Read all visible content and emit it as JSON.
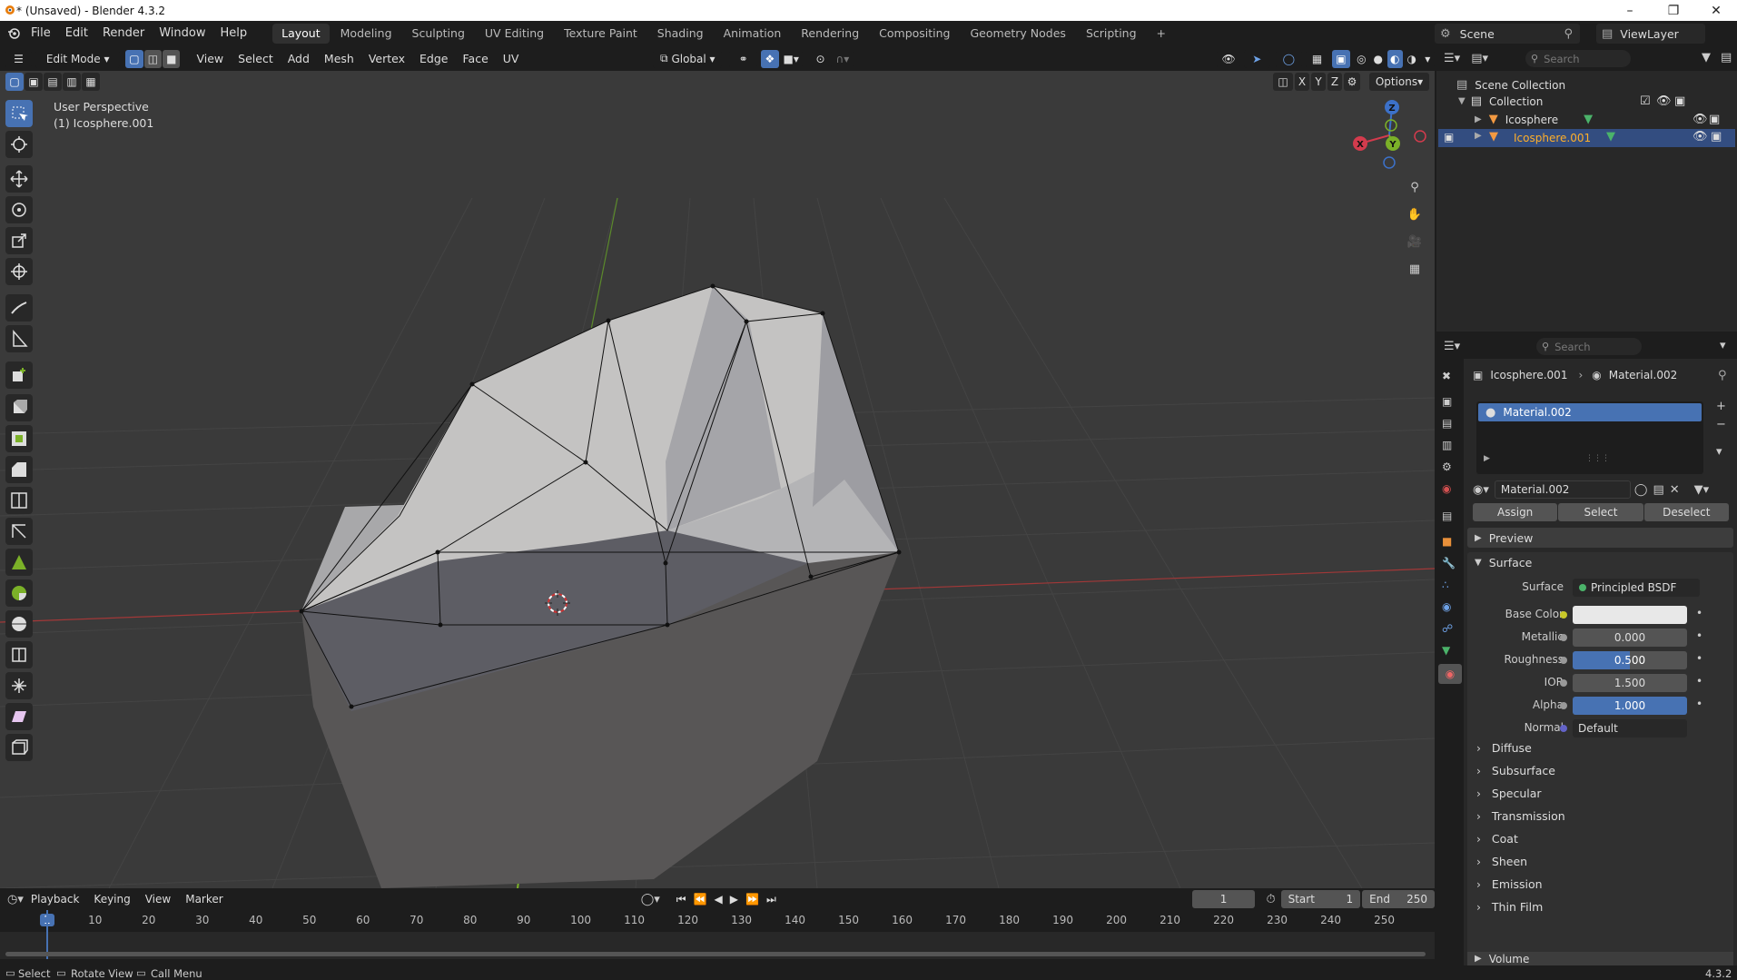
{
  "window": {
    "title": "* (Unsaved) - Blender 4.3.2"
  },
  "menu": {
    "items": [
      "File",
      "Edit",
      "Render",
      "Window",
      "Help"
    ]
  },
  "workspaces": {
    "tabs": [
      "Layout",
      "Modeling",
      "Sculpting",
      "UV Editing",
      "Texture Paint",
      "Shading",
      "Animation",
      "Rendering",
      "Compositing",
      "Geometry Nodes",
      "Scripting"
    ],
    "active": "Layout"
  },
  "scene": {
    "label": "Scene",
    "view_layer": "ViewLayer"
  },
  "viewport_header": {
    "mode": "Edit Mode",
    "menus": [
      "View",
      "Select",
      "Add",
      "Mesh",
      "Vertex",
      "Edge",
      "Face",
      "UV"
    ],
    "orientation": "Global",
    "options": "Options",
    "axes": [
      "X",
      "Y",
      "Z"
    ]
  },
  "viewport": {
    "perspective": "User Perspective",
    "object_info": "(1) Icosphere.001",
    "gizmo": {
      "x": "X",
      "y": "Y",
      "z": "Z"
    }
  },
  "outliner": {
    "search_placeholder": "Search",
    "scene_collection": "Scene Collection",
    "collection": "Collection",
    "objects": [
      "Icosphere",
      "Icosphere.001"
    ]
  },
  "properties": {
    "search_placeholder": "Search",
    "breadcrumb_object": "Icosphere.001",
    "breadcrumb_material": "Material.002",
    "slot_name": "Material.002",
    "material_name": "Material.002",
    "assign": "Assign",
    "select": "Select",
    "deselect": "Deselect",
    "preview": "Preview",
    "surface_panel": "Surface",
    "surface_label": "Surface",
    "surface_value": "Principled BSDF",
    "base_color_label": "Base Color",
    "metallic_label": "Metallic",
    "metallic_value": "0.000",
    "roughness_label": "Roughness",
    "roughness_value": "0.500",
    "ior_label": "IOR",
    "ior_value": "1.500",
    "alpha_label": "Alpha",
    "alpha_value": "1.000",
    "normal_label": "Normal",
    "normal_value": "Default",
    "subpanels": [
      "Diffuse",
      "Subsurface",
      "Specular",
      "Transmission",
      "Coat",
      "Sheen",
      "Emission",
      "Thin Film"
    ],
    "volume": "Volume"
  },
  "timeline": {
    "menus": [
      "Playback",
      "Keying",
      "View",
      "Marker"
    ],
    "current_frame": "1",
    "start_label": "Start",
    "start_value": "1",
    "end_label": "End",
    "end_value": "250",
    "ticks": [
      "1",
      "10",
      "20",
      "30",
      "40",
      "50",
      "60",
      "70",
      "80",
      "90",
      "100",
      "110",
      "120",
      "130",
      "140",
      "150",
      "160",
      "170",
      "180",
      "190",
      "200",
      "210",
      "220",
      "230",
      "240",
      "250"
    ]
  },
  "statusbar": {
    "select": "Select",
    "rotate": "Rotate View",
    "menu": "Call Menu",
    "version": "4.3.2"
  },
  "colors": {
    "accent": "#4772b3",
    "background": "#3a3a3a",
    "panel": "#282828",
    "selected_text": "#ffaf29"
  }
}
